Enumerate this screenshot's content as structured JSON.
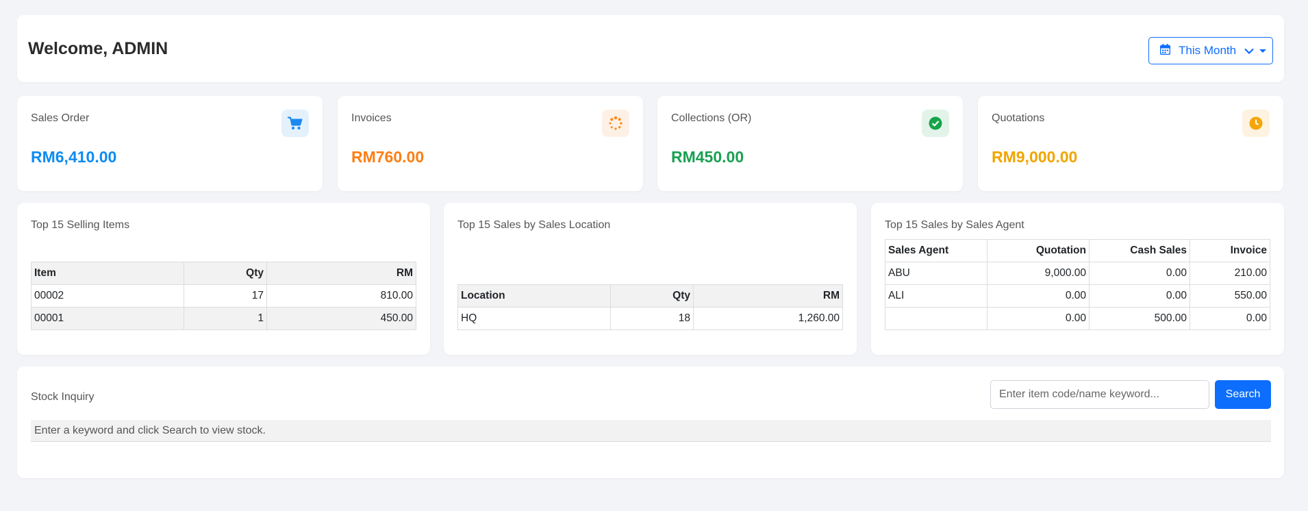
{
  "header": {
    "welcome": "Welcome, ADMIN",
    "period": "This Month"
  },
  "stats": [
    {
      "label": "Sales Order",
      "value": "RM6,410.00",
      "color": "#0d8bf2",
      "icon": "cart-icon"
    },
    {
      "label": "Invoices",
      "value": "RM760.00",
      "color": "#fd7e14",
      "icon": "spinner-icon"
    },
    {
      "label": "Collections (OR)",
      "value": "RM450.00",
      "color": "#1aa053",
      "icon": "check-circle-icon"
    },
    {
      "label": "Quotations",
      "value": "RM9,000.00",
      "color": "#f0a500",
      "icon": "clock-icon"
    }
  ],
  "top_items": {
    "title": "Top 15 Selling Items",
    "headers": [
      "Item",
      "Qty",
      "RM"
    ],
    "rows": [
      [
        "00002",
        "17",
        "810.00"
      ],
      [
        "00001",
        "1",
        "450.00"
      ]
    ]
  },
  "top_locations": {
    "title": "Top 15 Sales by Sales Location",
    "headers": [
      "Location",
      "Qty",
      "RM"
    ],
    "rows": [
      [
        "HQ",
        "18",
        "1,260.00"
      ]
    ]
  },
  "top_agents": {
    "title": "Top 15 Sales by Sales Agent",
    "headers": [
      "Sales Agent",
      "Quotation",
      "Cash Sales",
      "Invoice"
    ],
    "rows": [
      [
        "ABU",
        "9,000.00",
        "0.00",
        "210.00"
      ],
      [
        "ALI",
        "0.00",
        "0.00",
        "550.00"
      ],
      [
        "",
        "0.00",
        "500.00",
        "0.00"
      ]
    ]
  },
  "stock": {
    "title": "Stock Inquiry",
    "placeholder": "Enter item code/name keyword...",
    "search_label": "Search",
    "message": "Enter a keyword and click Search to view stock."
  }
}
